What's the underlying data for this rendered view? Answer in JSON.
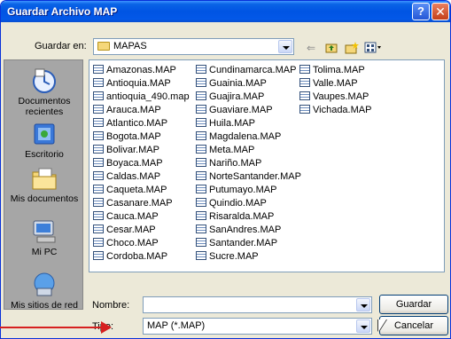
{
  "window": {
    "title": "Guardar Archivo MAP",
    "help_glyph": "?",
    "close_glyph": "✕"
  },
  "save_in": {
    "label": "Guardar en:",
    "value": "MAPAS"
  },
  "toolbar": {
    "back_icon": "back-arrow-icon",
    "up_icon": "up-folder-icon",
    "new_folder_icon": "new-folder-icon",
    "view_menu_icon": "view-menu-icon"
  },
  "places": [
    {
      "label": "Documentos recientes",
      "icon": "recent-documents-icon"
    },
    {
      "label": "Escritorio",
      "icon": "desktop-icon"
    },
    {
      "label": "Mis documentos",
      "icon": "my-documents-icon"
    },
    {
      "label": "Mi PC",
      "icon": "my-computer-icon"
    },
    {
      "label": "Mis sitios de red",
      "icon": "network-places-icon"
    }
  ],
  "files": {
    "col1": [
      "Amazonas.MAP",
      "Antioquia.MAP",
      "antioquia_490.map",
      "Arauca.MAP",
      "Atlantico.MAP",
      "Bogota.MAP",
      "Bolivar.MAP",
      "Boyaca.MAP",
      "Caldas.MAP",
      "Caqueta.MAP",
      "Casanare.MAP",
      "Cauca.MAP",
      "Cesar.MAP",
      "Choco.MAP",
      "Cordoba.MAP"
    ],
    "col2": [
      "Cundinamarca.MAP",
      "Guainia.MAP",
      "Guajira.MAP",
      "Guaviare.MAP",
      "Huila.MAP",
      "Magdalena.MAP",
      "Meta.MAP",
      "Nariño.MAP",
      "NorteSantander.MAP",
      "Putumayo.MAP",
      "Quindio.MAP",
      "Risaralda.MAP",
      "SanAndres.MAP",
      "Santander.MAP",
      "Sucre.MAP"
    ],
    "col3": [
      "Tolima.MAP",
      "Valle.MAP",
      "Vaupes.MAP",
      "Vichada.MAP"
    ]
  },
  "filename": {
    "label": "Nombre:",
    "value": ""
  },
  "filetype": {
    "label": "Tipo:",
    "value": "MAP (*.MAP)"
  },
  "buttons": {
    "save": "Guardar",
    "cancel": "Cancelar"
  },
  "colors": {
    "title_bar": "#0054e3",
    "dialog_bg": "#ece9d8",
    "places_bar": "#a6a6a6",
    "annotation_arrow": "#d62020"
  }
}
